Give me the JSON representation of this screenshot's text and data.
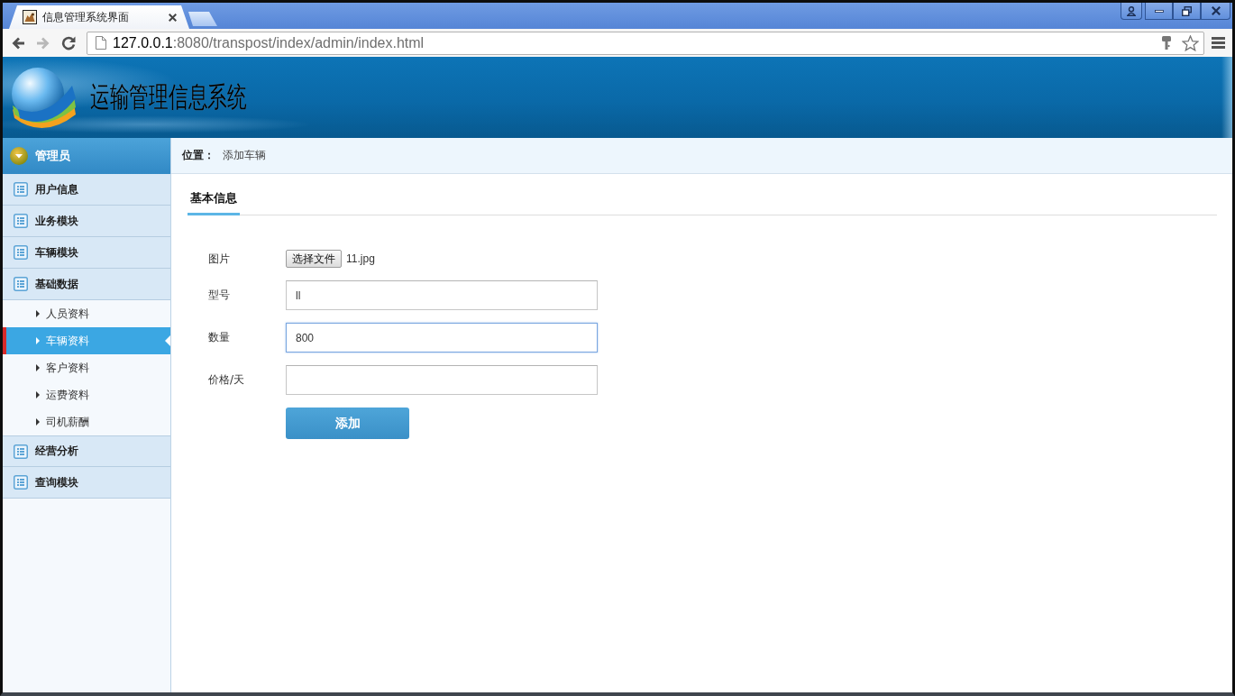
{
  "browser": {
    "tab": {
      "title": "信息管理系统界面"
    },
    "nav_buttons": [
      {
        "kind": "back",
        "disabled": false
      },
      {
        "kind": "forward",
        "disabled": true
      },
      {
        "kind": "reload",
        "disabled": false
      }
    ],
    "address": {
      "host": "127.0.0.1",
      "path": ":8080/transpost/index/admin/index.html"
    }
  },
  "header": {
    "title": "运输管理信息系统"
  },
  "sidebar": {
    "title": "管理员",
    "items": [
      {
        "label": "用户信息"
      },
      {
        "label": "业务模块"
      },
      {
        "label": "车辆模块"
      },
      {
        "label": "基础数据",
        "children": [
          {
            "label": "人员资料",
            "selected": false
          },
          {
            "label": "车辆资料",
            "selected": true
          },
          {
            "label": "客户资料",
            "selected": false
          },
          {
            "label": "运费资料",
            "selected": false
          },
          {
            "label": "司机薪酬",
            "selected": false
          }
        ]
      },
      {
        "label": "经营分析"
      },
      {
        "label": "查询模块"
      }
    ]
  },
  "breadcrumb": {
    "label": "位置：",
    "current": "添加车辆"
  },
  "tabs": [
    {
      "label": "基本信息",
      "selected": true
    }
  ],
  "form": {
    "fields": [
      {
        "kind": "file",
        "label": "图片",
        "button": "选择文件",
        "value": "11.jpg",
        "focused": false
      },
      {
        "kind": "text",
        "label": "型号",
        "value": "ll",
        "focused": false
      },
      {
        "kind": "text",
        "label": "数量",
        "value": "800",
        "focused": true
      },
      {
        "kind": "text",
        "label": "价格/天",
        "focused": false
      }
    ],
    "submit": "添加"
  }
}
